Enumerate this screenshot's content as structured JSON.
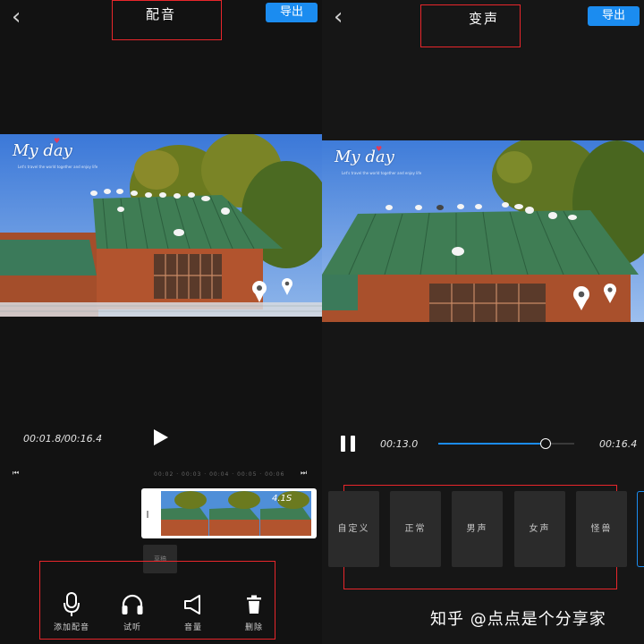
{
  "left": {
    "title": "配音",
    "export_label": "导出",
    "photo_text": "My day",
    "photo_subtext": "Let's travel the world together and enjoy life",
    "time_current": "00:01.8",
    "time_total": "00:16.4",
    "time_separator": "/",
    "ruler_ticks": [
      "00:02",
      "00:03",
      "00:04",
      "00:05",
      "00:06"
    ],
    "clip_duration": "4.1S",
    "clip_chip": "草稿",
    "tools": [
      {
        "label": "添加配音",
        "icon": "microphone-icon"
      },
      {
        "label": "试听",
        "icon": "headphones-icon"
      },
      {
        "label": "音量",
        "icon": "speaker-icon"
      },
      {
        "label": "删除",
        "icon": "trash-icon"
      }
    ]
  },
  "right": {
    "title": "变声",
    "export_label": "导出",
    "photo_text": "My day",
    "photo_subtext": "Let's travel the world together and enjoy life",
    "time_current": "00:13.0",
    "time_total": "00:16.4",
    "playback_progress": 0.79,
    "voices": [
      "自定义",
      "正常",
      "男声",
      "女声",
      "怪兽"
    ]
  },
  "watermark": "知乎 @点点是个分享家",
  "colors": {
    "accent": "#1b8cf0",
    "highlight_box": "#e8262b",
    "background": "#121212"
  }
}
